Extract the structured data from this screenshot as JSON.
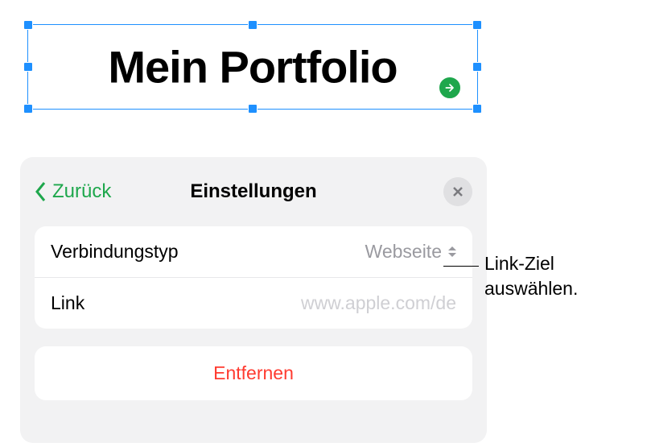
{
  "textbox": {
    "title": "Mein Portfolio"
  },
  "panel": {
    "back_label": "Zurück",
    "title": "Einstellungen",
    "rows": {
      "link_type": {
        "label": "Verbindungstyp",
        "value": "Webseite"
      },
      "link": {
        "label": "Link",
        "placeholder": "www.apple.com/de"
      }
    },
    "remove_label": "Entfernen"
  },
  "callout": {
    "line1": "Link-Ziel",
    "line2": "auswählen."
  }
}
